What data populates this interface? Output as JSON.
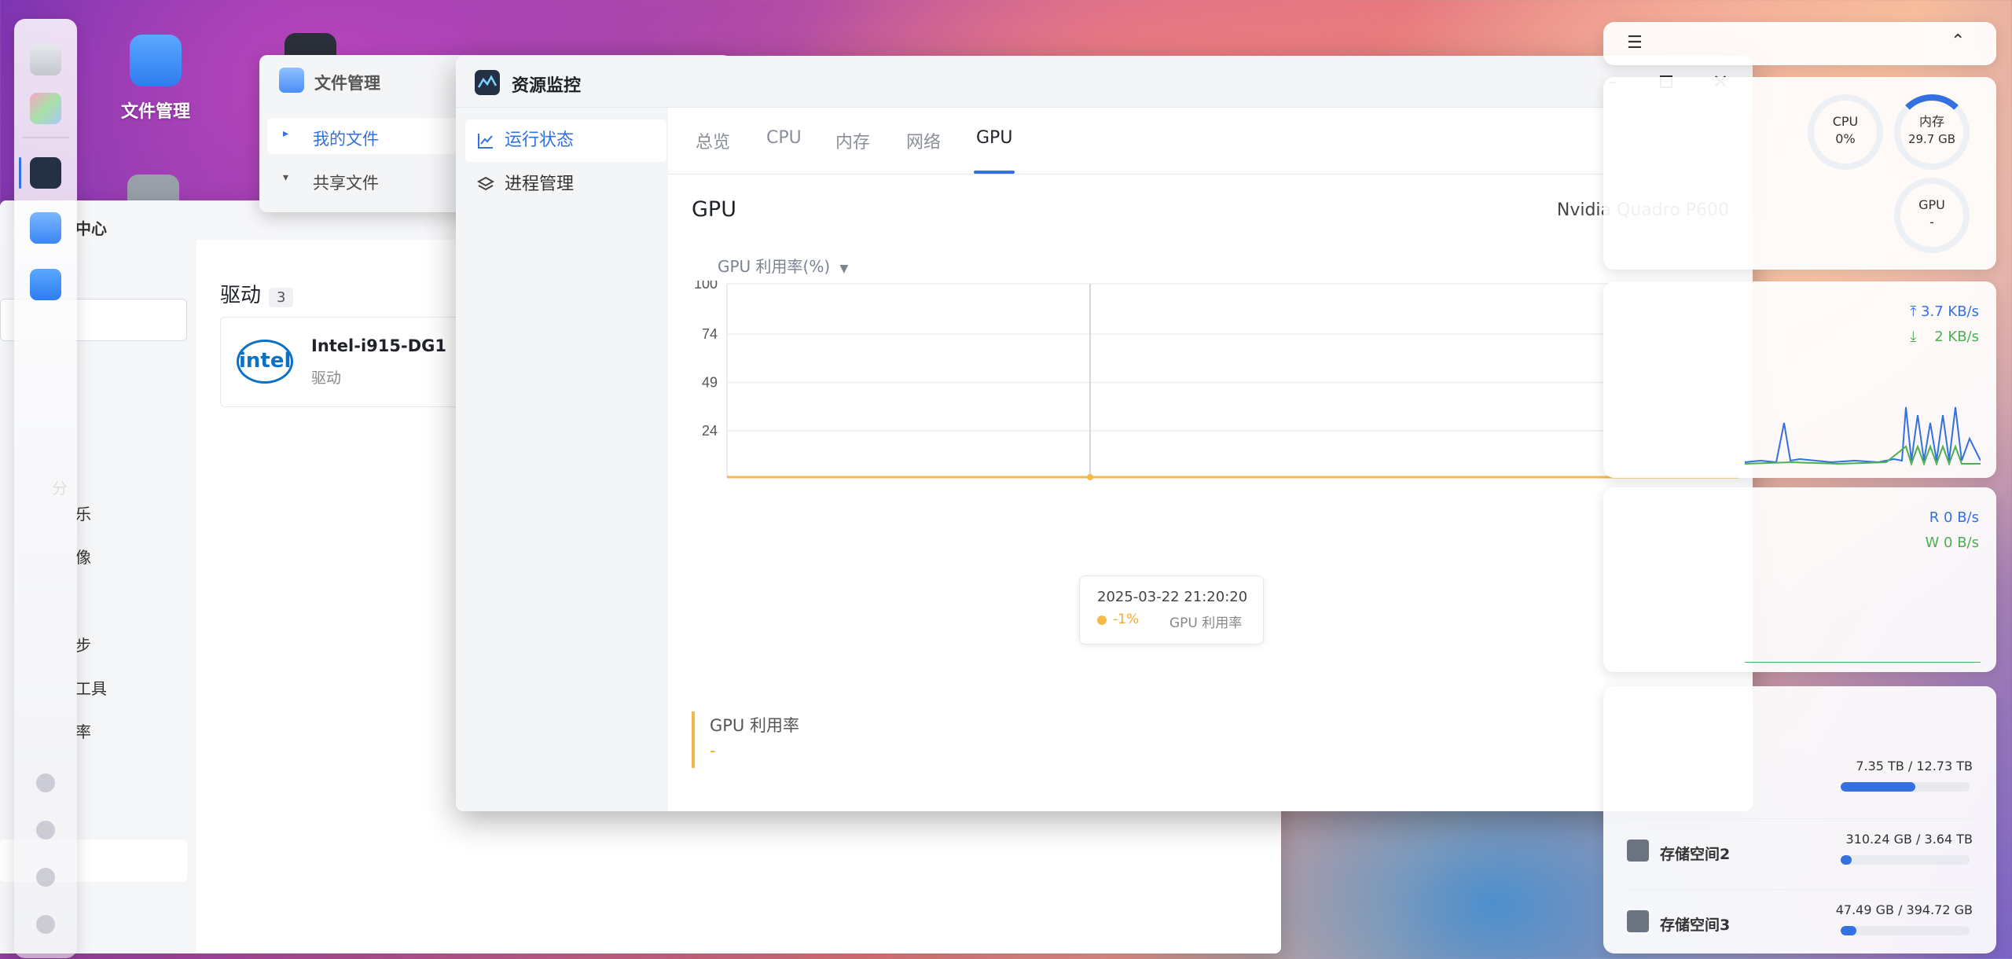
{
  "desktop": {
    "file_manager_label": "文件管理"
  },
  "back_window": {
    "title_partial": "中心",
    "drivers_heading": "驱动",
    "drivers_count": "3",
    "driver_card": {
      "name": "Intel-i915-DG1",
      "type": "驱动",
      "logo_text": "intel"
    },
    "sidebar_partial_labels": [
      "分",
      "乐",
      "像",
      "步",
      "工具",
      "率"
    ]
  },
  "file_manager": {
    "title": "文件管理",
    "items": [
      "我的文件",
      "共享文件"
    ]
  },
  "resource_monitor": {
    "title": "资源监控",
    "nav": [
      "运行状态",
      "进程管理"
    ],
    "tabs": [
      "总览",
      "CPU",
      "内存",
      "网络",
      "GPU"
    ],
    "active_tab": "GPU",
    "section_title": "GPU",
    "gpu_model": "Nvidia Quadro P600",
    "metric_selector": "GPU 利用率(%)",
    "tooltip": {
      "time": "2025-03-22 21:20:20",
      "value": "-1%",
      "series": "GPU 利用率"
    },
    "summary": {
      "label": "GPU 利用率",
      "value": "-"
    }
  },
  "chart_data": {
    "type": "line",
    "title": "",
    "xlabel": "",
    "ylabel": "GPU 利用率(%)",
    "ylim": [
      0,
      100
    ],
    "yticks": [
      24,
      49,
      74,
      100
    ],
    "grid": true,
    "series": [
      {
        "name": "GPU 利用率",
        "color": "#f5b94b",
        "values": [
          0,
          0,
          0,
          0,
          0,
          0,
          0,
          0,
          0,
          0,
          0,
          0,
          0,
          0,
          0,
          0,
          0,
          0,
          0,
          0,
          0,
          0,
          0,
          0,
          0,
          0,
          0,
          0,
          0,
          0,
          0,
          0,
          0,
          0,
          0,
          0,
          0,
          0,
          0,
          0
        ]
      }
    ],
    "crosshair_index": 14
  },
  "widgets": {
    "cpu": {
      "label": "CPU",
      "value": "0%"
    },
    "memory": {
      "label": "内存",
      "value": "29.7 GB"
    },
    "gpu": {
      "label": "GPU",
      "value": "-"
    },
    "network": {
      "upload": "3.7 KB/s",
      "download": "2 KB/s"
    },
    "disk_io": {
      "read": "R 0 B/s",
      "write": "W 0 B/s"
    },
    "storage": [
      {
        "name": "",
        "used": "7.35 TB",
        "total": "12.73 TB",
        "fraction": 0.577
      },
      {
        "name": "存储空间2",
        "used": "310.24 GB",
        "total": "3.64 TB",
        "fraction": 0.083
      },
      {
        "name": "存储空间3",
        "used": "47.49 GB",
        "total": "394.72 GB",
        "fraction": 0.12
      }
    ]
  },
  "colors": {
    "accent": "#3370e0",
    "gpu_series": "#f5b94b",
    "net_upload": "#3370e0",
    "net_download": "#4caf50"
  }
}
